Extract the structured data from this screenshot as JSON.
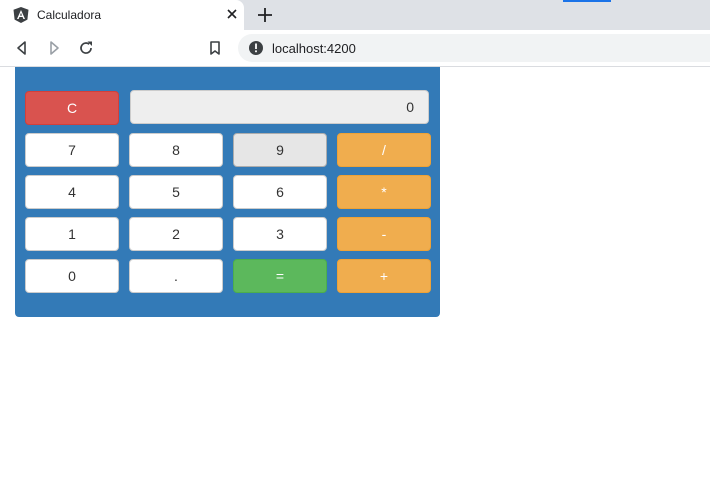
{
  "browser": {
    "tab_title": "Calculadora",
    "url": "localhost:4200",
    "accent_color": "#1a73e8"
  },
  "calculator": {
    "display_value": "0",
    "clear_label": "C",
    "keys": {
      "seven": "7",
      "eight": "8",
      "nine": "9",
      "divide": "/",
      "four": "4",
      "five": "5",
      "six": "6",
      "multiply": "*",
      "one": "1",
      "two": "2",
      "three": "3",
      "subtract": "-",
      "zero": "0",
      "decimal": ".",
      "equals": "=",
      "add": "+"
    },
    "colors": {
      "panel": "#337ab7",
      "clear": "#d9534f",
      "equals": "#5cb85c",
      "operator": "#f0ad4e",
      "digit": "#ffffff",
      "display": "#eeeeee"
    }
  }
}
